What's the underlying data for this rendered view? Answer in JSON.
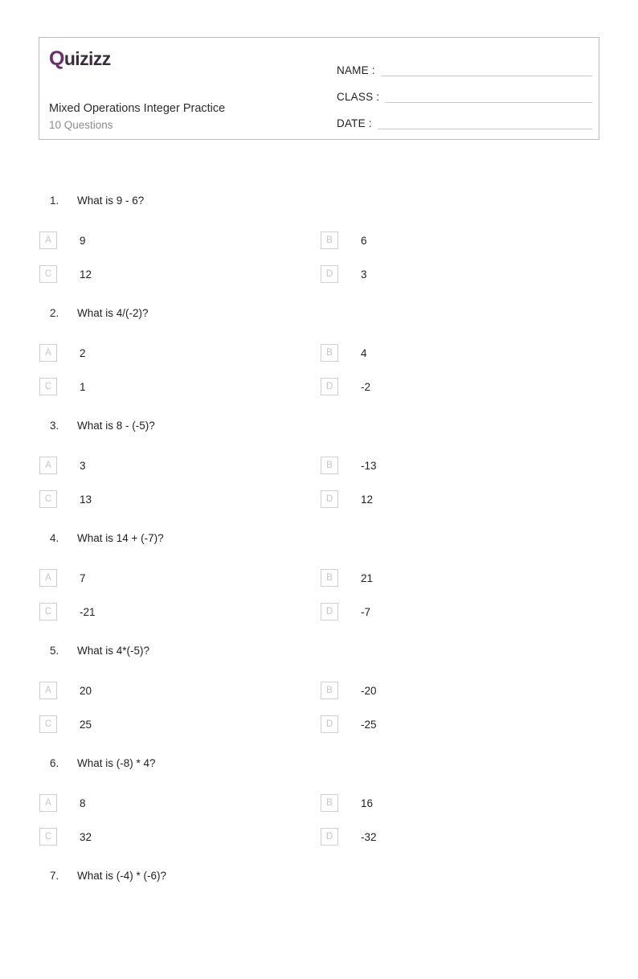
{
  "header": {
    "logo": {
      "first_letter": "Q",
      "rest": "uizizz"
    },
    "title": "Mixed Operations Integer Practice",
    "subtitle": "10 Questions",
    "fields": [
      {
        "label": "NAME :",
        "value": ""
      },
      {
        "label": "CLASS :",
        "value": ""
      },
      {
        "label": "DATE  :",
        "value": ""
      }
    ]
  },
  "colors": {
    "logo_purple": "#6b2d6e",
    "logo_dark": "#3a2c3f",
    "border": "#bdbdbd",
    "letter_box_border": "#cfcfcf",
    "letter_box_text": "#c4c4c4",
    "subtitle": "#8d8d8d"
  },
  "questions": [
    {
      "number": "1.",
      "text": "What is 9 - 6?",
      "options": [
        {
          "letter": "A",
          "text": "9"
        },
        {
          "letter": "B",
          "text": "6"
        },
        {
          "letter": "C",
          "text": "12"
        },
        {
          "letter": "D",
          "text": "3"
        }
      ]
    },
    {
      "number": "2.",
      "text": "What is 4/(-2)?",
      "options": [
        {
          "letter": "A",
          "text": "2"
        },
        {
          "letter": "B",
          "text": "4"
        },
        {
          "letter": "C",
          "text": "1"
        },
        {
          "letter": "D",
          "text": "-2"
        }
      ]
    },
    {
      "number": "3.",
      "text": "What is 8 - (-5)?",
      "options": [
        {
          "letter": "A",
          "text": "3"
        },
        {
          "letter": "B",
          "text": "-13"
        },
        {
          "letter": "C",
          "text": "13"
        },
        {
          "letter": "D",
          "text": "12"
        }
      ]
    },
    {
      "number": "4.",
      "text": "What is 14 + (-7)?",
      "options": [
        {
          "letter": "A",
          "text": "7"
        },
        {
          "letter": "B",
          "text": "21"
        },
        {
          "letter": "C",
          "text": "-21"
        },
        {
          "letter": "D",
          "text": "-7"
        }
      ]
    },
    {
      "number": "5.",
      "text": "What is 4*(-5)?",
      "options": [
        {
          "letter": "A",
          "text": "20"
        },
        {
          "letter": "B",
          "text": "-20"
        },
        {
          "letter": "C",
          "text": "25"
        },
        {
          "letter": "D",
          "text": "-25"
        }
      ]
    },
    {
      "number": "6.",
      "text": "What is (-8) * 4?",
      "options": [
        {
          "letter": "A",
          "text": "8"
        },
        {
          "letter": "B",
          "text": "16"
        },
        {
          "letter": "C",
          "text": "32"
        },
        {
          "letter": "D",
          "text": "-32"
        }
      ]
    },
    {
      "number": "7.",
      "text": "What is (-4) * (-6)?",
      "options": []
    }
  ]
}
